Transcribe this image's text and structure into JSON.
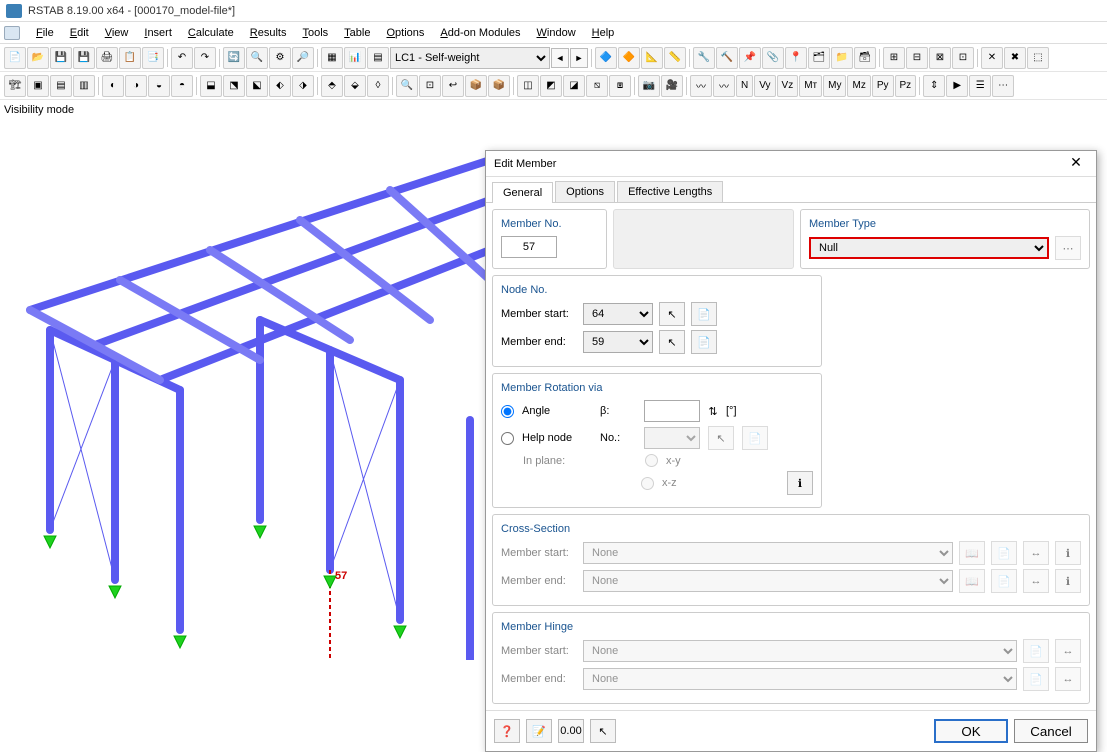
{
  "app": {
    "title": "RSTAB 8.19.00 x64 - [000170_model-file*]"
  },
  "menu": {
    "items": [
      "File",
      "Edit",
      "View",
      "Insert",
      "Calculate",
      "Results",
      "Tools",
      "Table",
      "Options",
      "Add-on Modules",
      "Window",
      "Help"
    ]
  },
  "toolbar": {
    "loadcase": "LC1 - Self-weight"
  },
  "viewport": {
    "mode_label": "Visibility mode",
    "selected_member": "57"
  },
  "dialog": {
    "title": "Edit Member",
    "tabs": [
      "General",
      "Options",
      "Effective Lengths"
    ],
    "active_tab": 0,
    "member_no": {
      "label": "Member No.",
      "value": "57"
    },
    "member_type": {
      "label": "Member Type",
      "value": "Null"
    },
    "node": {
      "label": "Node No.",
      "start_label": "Member start:",
      "start_value": "64",
      "end_label": "Member end:",
      "end_value": "59"
    },
    "rotation": {
      "label": "Member Rotation via",
      "angle_label": "Angle",
      "beta_label": "β:",
      "beta_unit": "[°]",
      "helpnode_label": "Help node",
      "no_label": "No.:",
      "inplane_label": "In plane:",
      "xy": "x-y",
      "xz": "x-z"
    },
    "cross_section": {
      "label": "Cross-Section",
      "start_label": "Member start:",
      "start_value": "None",
      "end_label": "Member end:",
      "end_value": "None"
    },
    "hinge": {
      "label": "Member Hinge",
      "start_label": "Member start:",
      "start_value": "None",
      "end_label": "Member end:",
      "end_value": "None"
    },
    "buttons": {
      "ok": "OK",
      "cancel": "Cancel"
    }
  }
}
